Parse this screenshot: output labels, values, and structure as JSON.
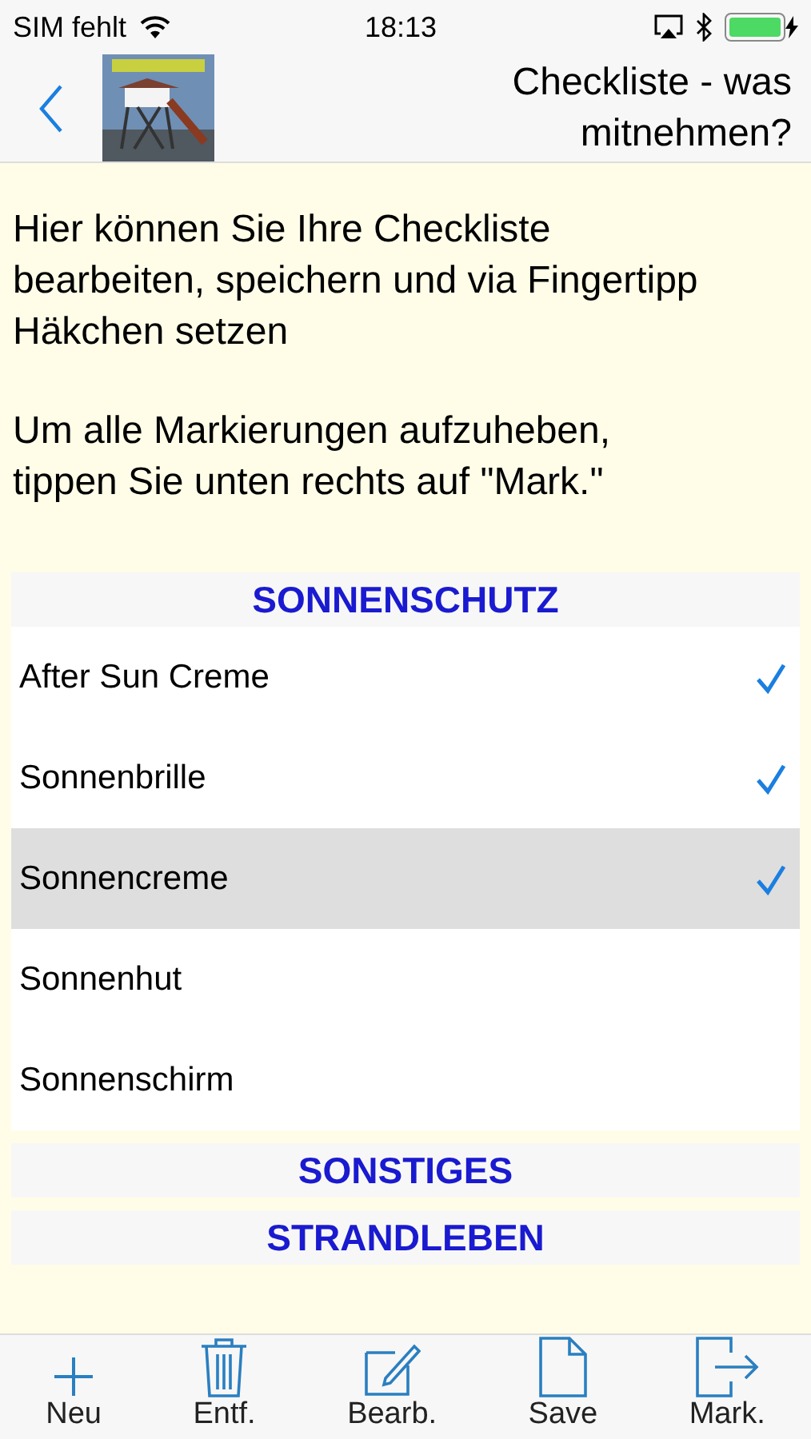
{
  "status_bar": {
    "carrier": "SIM fehlt",
    "time": "18:13"
  },
  "nav": {
    "title": "Checkliste - was mitnehmen?"
  },
  "intro": [
    "Hier können Sie Ihre Checkliste bearbeiten, speichern und via Fingertipp Häkchen setzen",
    "Um alle Markierungen aufzuheben, tippen Sie unten rechts auf \"Mark.\""
  ],
  "sections": [
    {
      "title": "SONNENSCHUTZ",
      "items": [
        {
          "label": "After Sun Creme",
          "checked": true,
          "selected": false
        },
        {
          "label": "Sonnenbrille",
          "checked": true,
          "selected": false
        },
        {
          "label": "Sonnencreme",
          "checked": true,
          "selected": true
        },
        {
          "label": "Sonnenhut",
          "checked": false,
          "selected": false
        },
        {
          "label": "Sonnenschirm",
          "checked": false,
          "selected": false
        }
      ]
    },
    {
      "title": "SONSTIGES"
    },
    {
      "title": "STRANDLEBEN"
    }
  ],
  "toolbar": [
    {
      "kind": "add",
      "label": "Neu"
    },
    {
      "kind": "delete",
      "label": "Entf."
    },
    {
      "kind": "edit",
      "label": "Bearb."
    },
    {
      "kind": "save",
      "label": "Save"
    },
    {
      "kind": "mark",
      "label": "Mark."
    }
  ]
}
